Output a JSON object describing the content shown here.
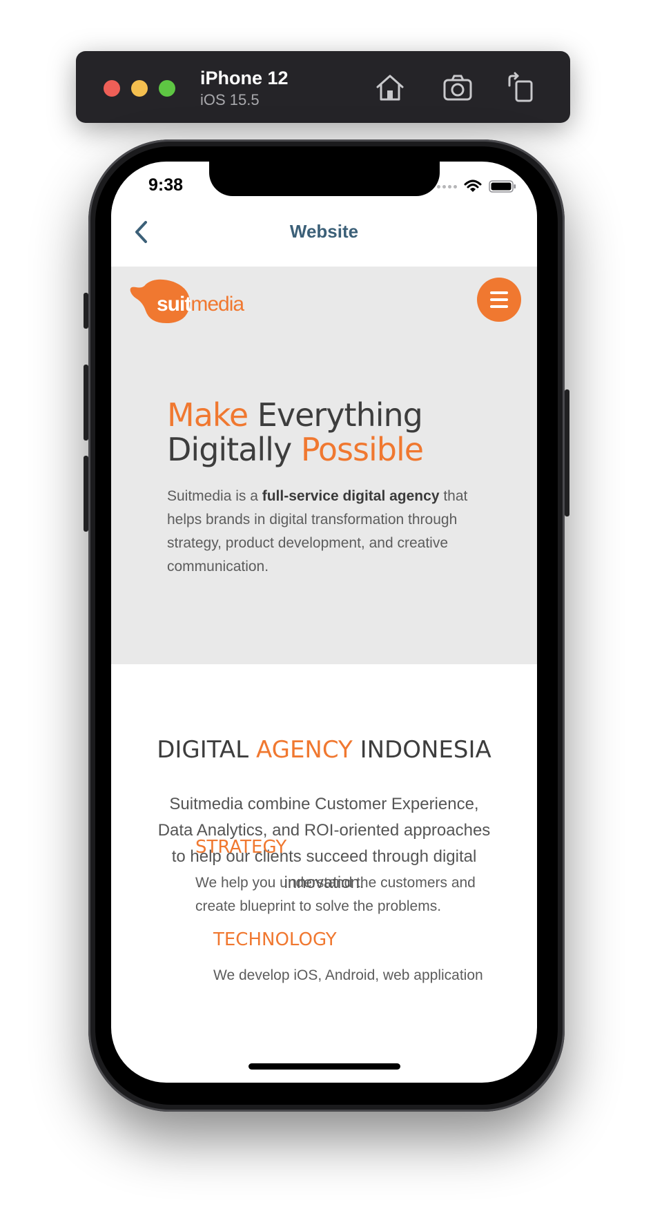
{
  "simulator": {
    "device_name": "iPhone 12",
    "os_version": "iOS 15.5",
    "icons": [
      "home-icon",
      "screenshot-icon",
      "rotate-icon"
    ]
  },
  "status_bar": {
    "time": "9:38"
  },
  "nav": {
    "title": "Website",
    "back_icon": "chevron-left-icon"
  },
  "header": {
    "logo_bold": "suit",
    "logo_rest": "media",
    "menu_icon": "hamburger-icon"
  },
  "hero": {
    "title_line1_accent": "Make",
    "title_line1_rest": " Everything",
    "title_line2_start": "Digitally ",
    "title_line2_accent": "Possible",
    "desc_prefix": "Suitmedia is a ",
    "desc_bold": "full-service digital agency",
    "desc_suffix": " that helps brands in digital transformation through strategy, product development, and creative communication."
  },
  "agency": {
    "title_start": "DIGITAL ",
    "title_accent": "AGENCY",
    "title_end": " INDONESIA",
    "description": "Suitmedia combine Customer Experience, Data Analytics, and ROI-oriented approaches to help our clients succeed through digital innovation."
  },
  "features": [
    {
      "title": "STRATEGY",
      "description": "We help you understand the customers and create blueprint to solve the problems."
    },
    {
      "title": "TECHNOLOGY",
      "description": "We develop iOS, Android, web application"
    }
  ],
  "colors": {
    "accent": "#f07830",
    "nav_title": "#3c6078",
    "hero_bg": "#e9e9e9",
    "toolbar_bg": "#252428"
  }
}
